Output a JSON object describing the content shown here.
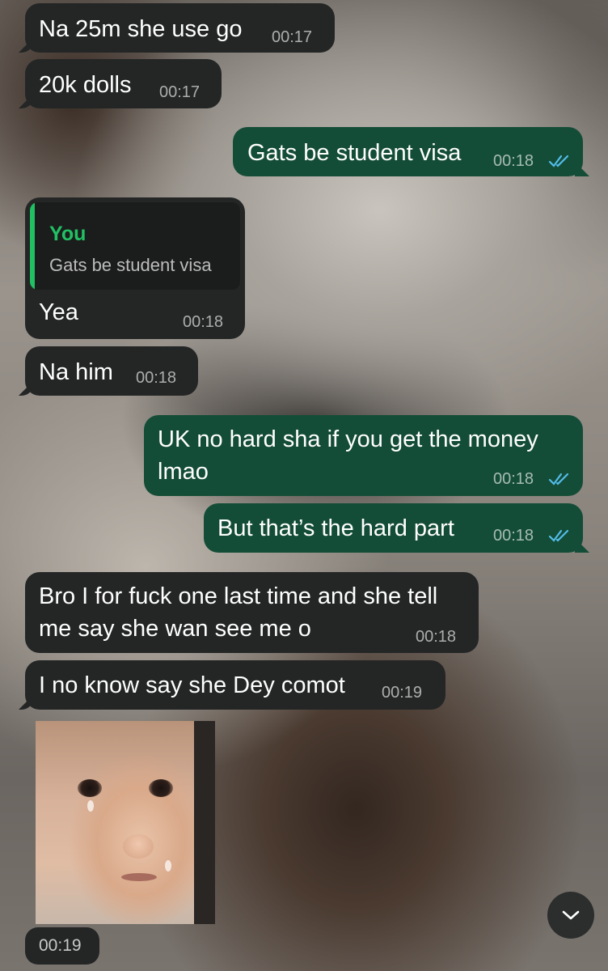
{
  "messages": [
    {
      "direction": "incoming",
      "text": "Na 25m she use go",
      "time": "00:17"
    },
    {
      "direction": "incoming",
      "text": "20k dolls",
      "time": "00:17"
    },
    {
      "direction": "outgoing",
      "text": "Gats be student visa",
      "time": "00:18",
      "status": "read"
    },
    {
      "direction": "incoming",
      "reply_to": {
        "sender": "You",
        "text": "Gats be student visa"
      },
      "text": "Yea",
      "time": "00:18"
    },
    {
      "direction": "incoming",
      "text": "Na him",
      "time": "00:18"
    },
    {
      "direction": "outgoing",
      "lines": [
        "UK no hard sha if you get the money",
        "lmao"
      ],
      "time": "00:18",
      "status": "read"
    },
    {
      "direction": "outgoing",
      "text": "But that’s the hard part",
      "time": "00:18",
      "status": "read"
    },
    {
      "direction": "incoming",
      "lines": [
        "Bro I for fuck one last time and she tell",
        "me say she wan see me o"
      ],
      "time": "00:18"
    },
    {
      "direction": "incoming",
      "text": "I no know say she Dey comot",
      "time": "00:19"
    },
    {
      "direction": "incoming",
      "type": "image",
      "image": "crying-baby-sticker",
      "time": "00:19"
    }
  ],
  "controls": {
    "scroll_down_icon": "chevron-down-icon"
  },
  "colors": {
    "incoming_bubble": "#242626",
    "outgoing_bubble": "#144d37",
    "reply_accent": "#21c063",
    "read_ticks": "#53bdeb"
  }
}
